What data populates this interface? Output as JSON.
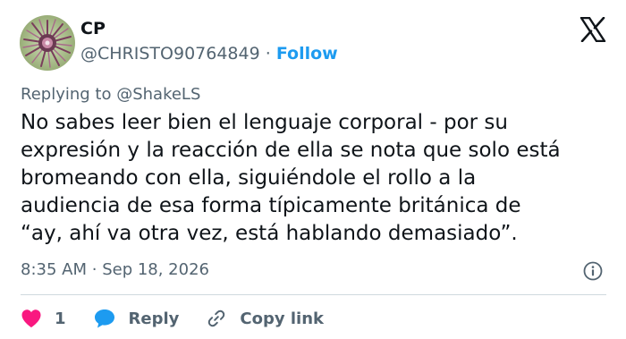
{
  "author": {
    "name": "CP",
    "handle": "@CHRISTO90764849",
    "separator": "·",
    "follow_label": "Follow"
  },
  "reply_context": {
    "prefix": "Replying to ",
    "handle": "@ShakeLS"
  },
  "body_lines": [
    "No sabes leer bien el lenguaje corporal - por su",
    "expresión y la reacción de ella se nota que solo está",
    "bromeando con ella, siguiéndole el rollo a la",
    "audiencia de esa forma típicamente británica de",
    "“ay, ahí va otra vez, está hablando demasiado”."
  ],
  "meta": {
    "time": "8:35 AM",
    "separator": "·",
    "date": "Sep 18, 2026"
  },
  "actions": {
    "like_count": "1",
    "reply_label": "Reply",
    "copy_link_label": "Copy link"
  },
  "icons": {
    "brand": "x-logo-icon",
    "info": "info-icon",
    "like": "heart-icon",
    "reply": "speech-bubble-icon",
    "copy": "link-icon"
  },
  "colors": {
    "text": "#0f1419",
    "secondary": "#536471",
    "accent": "#1d9bf0",
    "like": "#f91880",
    "divider": "#cfd9de"
  }
}
